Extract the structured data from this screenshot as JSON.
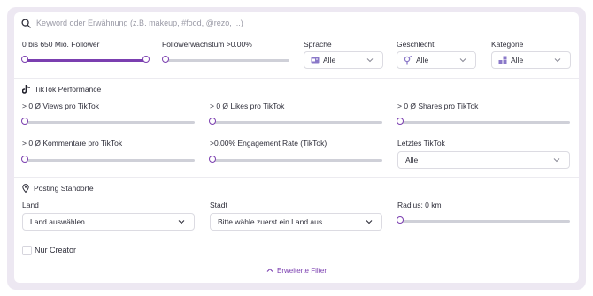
{
  "search": {
    "placeholder": "Keyword oder Erwähnung (z.B. makeup, #food, @rezo, ...)"
  },
  "filters": {
    "followers": {
      "label": "0 bis 650 Mio. Follower",
      "range_low": 0,
      "range_high": 1
    },
    "growth": {
      "label": "Followerwachstum >0.00%",
      "value": 0
    },
    "language": {
      "label": "Sprache",
      "value": "Alle"
    },
    "gender": {
      "label": "Geschlecht",
      "value": "Alle"
    },
    "category": {
      "label": "Kategorie",
      "value": "Alle"
    }
  },
  "tiktok": {
    "title": "TikTok Performance",
    "views": {
      "label": "> 0 Ø Views pro TikTok",
      "value": 0
    },
    "likes": {
      "label": "> 0 Ø Likes pro TikTok",
      "value": 0
    },
    "shares": {
      "label": "> 0 Ø Shares pro TikTok",
      "value": 0
    },
    "comments": {
      "label": "> 0 Ø Kommentare pro TikTok",
      "value": 0
    },
    "engagement": {
      "label": ">0.00% Engagement Rate (TikTok)",
      "value": 0
    },
    "last_tiktok": {
      "label": "Letztes TikTok",
      "value": "Alle"
    }
  },
  "posting": {
    "title": "Posting Standorte",
    "country": {
      "label": "Land",
      "value": "Land auswählen"
    },
    "city": {
      "label": "Stadt",
      "value": "Bitte wähle zuerst ein Land aus"
    },
    "radius": {
      "label": "Radius: 0 km",
      "value": 0
    }
  },
  "creator_only": {
    "label": "Nur Creator",
    "checked": false
  },
  "advanced": {
    "label": "Erweiterte Filter"
  },
  "colors": {
    "accent": "#7b3fb0",
    "track": "#cfd0d8",
    "frame": "#ede8f2"
  }
}
